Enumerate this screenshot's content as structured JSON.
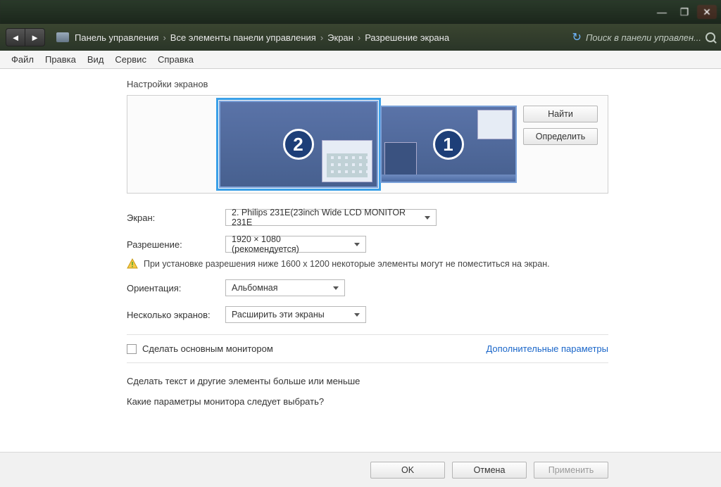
{
  "window": {
    "minimize": "—",
    "maximize": "❐",
    "close": "✕"
  },
  "nav": {
    "back": "◄",
    "forward": "►",
    "crumbs": [
      "Панель управления",
      "Все элементы панели управления",
      "Экран",
      "Разрешение экрана"
    ],
    "search_placeholder": "Поиск в панели управлен..."
  },
  "menu": [
    "Файл",
    "Правка",
    "Вид",
    "Сервис",
    "Справка"
  ],
  "title": "Настройки экранов",
  "monitors": {
    "primary": "1",
    "secondary": "2"
  },
  "buttons": {
    "find": "Найти",
    "identify": "Определить"
  },
  "fields": {
    "screen_label": "Экран:",
    "screen_value": "2. Philips 231E(23inch Wide LCD MONITOR 231E",
    "resolution_label": "Разрешение:",
    "resolution_value": "1920 × 1080 (рекомендуется)",
    "warning": "При установке разрешения ниже 1600 x 1200 некоторые элементы могут не поместиться на экран.",
    "orientation_label": "Ориентация:",
    "orientation_value": "Альбомная",
    "multi_label": "Несколько экранов:",
    "multi_value": "Расширить эти экраны"
  },
  "checkbox": {
    "label": "Сделать основным монитором",
    "advanced": "Дополнительные параметры"
  },
  "links": {
    "text_size": "Сделать текст и другие элементы больше или меньше",
    "which_settings": "Какие параметры монитора следует выбрать?"
  },
  "footer": {
    "ok": "OK",
    "cancel": "Отмена",
    "apply": "Применить"
  }
}
